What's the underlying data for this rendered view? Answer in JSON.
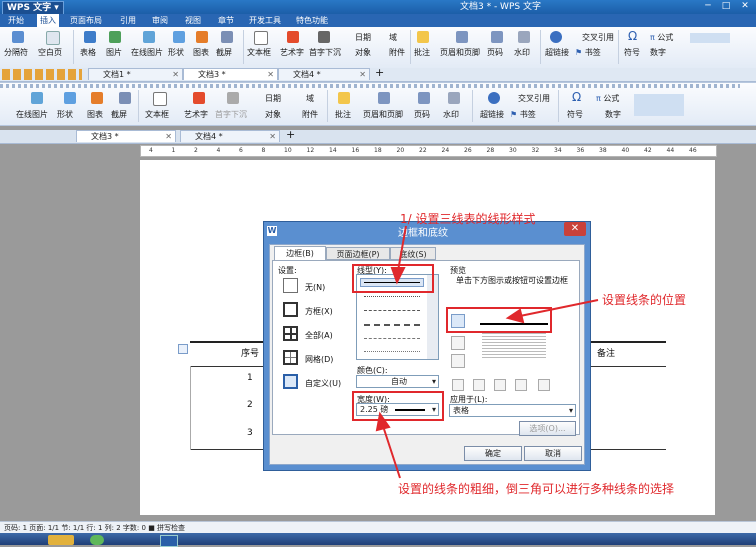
{
  "title_bar": {
    "app_name": "WPS 文字",
    "doc_title": "文档3 * - WPS 文字"
  },
  "menu": [
    "开始",
    "插入",
    "页面布局",
    "引用",
    "审阅",
    "视图",
    "章节",
    "开发工具",
    "特色功能"
  ],
  "menu_active": "插入",
  "ribbon1": {
    "items": [
      "分隔符",
      "空白页",
      "表格",
      "图片",
      "在线图片",
      "形状",
      "图表",
      "截屏",
      "文本框",
      "艺术字",
      "首字下沉",
      "日期",
      "对象",
      "域",
      "附件",
      "批注",
      "页眉和页脚",
      "页码",
      "水印",
      "超链接",
      "交叉引用",
      "书签",
      "符号",
      "公式",
      "数字"
    ]
  },
  "tabs1": [
    {
      "label": "文档1 *"
    },
    {
      "label": "文档3 *"
    },
    {
      "label": "文档4 *"
    }
  ],
  "ribbon2": {
    "items": [
      "在线图片",
      "形状",
      "图表",
      "截屏",
      "文本框",
      "艺术字",
      "首字下沉",
      "日期",
      "对象",
      "域",
      "附件",
      "批注",
      "页眉和页脚",
      "页码",
      "水印",
      "超链接",
      "交叉引用",
      "书签",
      "符号",
      "公式",
      "数字"
    ]
  },
  "tabs2": [
    {
      "label": "文档3 *"
    },
    {
      "label": "文档4 *"
    }
  ],
  "ruler_ticks": [
    "4",
    "1",
    "2",
    "4",
    "6",
    "8",
    "10",
    "12",
    "14",
    "16",
    "18",
    "20",
    "22",
    "24",
    "26",
    "28",
    "30",
    "32",
    "34",
    "36",
    "38",
    "40",
    "42",
    "44",
    "46"
  ],
  "document_table": {
    "headers": [
      "序号",
      "备注"
    ],
    "rows": [
      "1",
      "2",
      "3"
    ]
  },
  "dialog": {
    "title": "边框和底纹",
    "tabs": [
      "边框(B)",
      "页面边框(P)",
      "底纹(S)"
    ],
    "settings_label": "设置:",
    "settings": [
      "无(N)",
      "方框(X)",
      "全部(A)",
      "网格(D)",
      "自定义(U)"
    ],
    "linestyle_label": "线型(Y):",
    "color_label": "颜色(C):",
    "color_value": "自动",
    "width_label": "宽度(W):",
    "width_value": "2.25 磅",
    "preview_label": "预览",
    "preview_hint": "单击下方图示或按钮可设置边框",
    "apply_label": "应用于(L):",
    "apply_value": "表格",
    "options_button": "选项(O)...",
    "ok_button": "确定",
    "cancel_button": "取消"
  },
  "annotations": {
    "step1": "1/ 设置三线表的线形样式",
    "position": "设置线条的位置",
    "width": "设置的线条的粗细，倒三角可以进行多种线条的选择"
  },
  "status_bar": "页码: 1  页面: 1/1  节: 1/1  行: 1  列: 2  字数: 0  ■ 拼写检查",
  "colors": {
    "accent": "#2a78c6",
    "annotation": "#e0282c",
    "dialog_frame": "#5a8fd0"
  }
}
